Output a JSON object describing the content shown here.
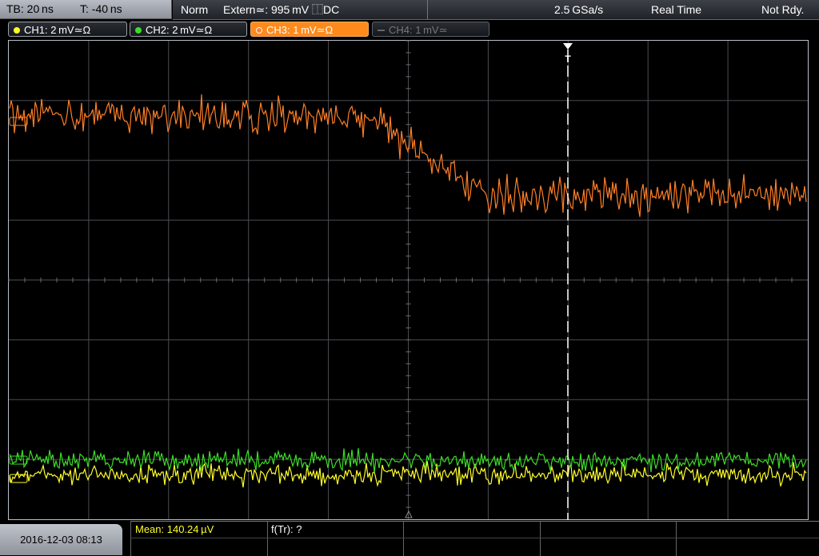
{
  "status_bar": {
    "timebase": "TB: 20 ns",
    "trigger_time": "T: -40 ns",
    "acq_mode": "Norm",
    "trigger_source": "Extern≃: 995 mV ⿰DC",
    "sample_rate": "2.5 GSa/s",
    "acq_type": "Real Time",
    "run_state": "Not Rdy."
  },
  "channels": [
    {
      "label": "CH1: 2 mV≃Ω",
      "color": "#ffff2a",
      "state": "on"
    },
    {
      "label": "CH2: 2 mV≃Ω",
      "color": "#3cdc28",
      "state": "on"
    },
    {
      "label": "CH3: 1 mV≃Ω",
      "color": "#ff7f27",
      "state": "selected"
    },
    {
      "label": "CH4: 1 mV≃",
      "color": "#666666",
      "state": "off"
    }
  ],
  "trigger_marker": "T",
  "datetime": "2016-12-03 08:13",
  "measurements": {
    "mean": "Mean: 140.24 µV",
    "f_tr": "f(Tr): ?"
  },
  "colors": {
    "ch1": "#ffff2a",
    "ch2": "#3cdc28",
    "ch3": "#ff7f27",
    "grid": "#4a4d52",
    "accent_tab": "#ff8a1c"
  }
}
